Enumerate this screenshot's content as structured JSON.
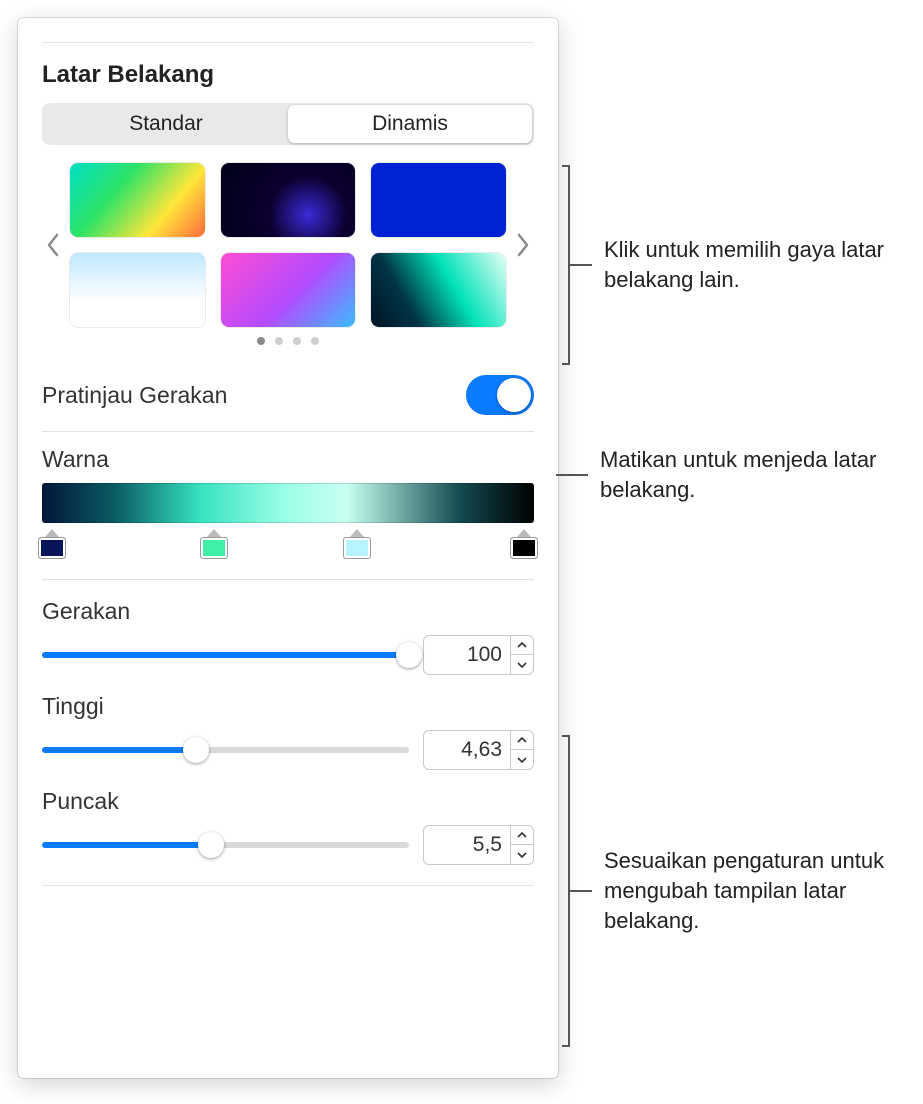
{
  "section_title": "Latar Belakang",
  "segmented": {
    "standard_label": "Standar",
    "dynamic_label": "Dinamis",
    "selected": "Dinamis"
  },
  "gallery": {
    "page_count": 4,
    "current_page": 1
  },
  "motion_preview": {
    "label": "Pratinjau Gerakan",
    "enabled": true
  },
  "color_section": {
    "label": "Warna",
    "stops": [
      {
        "position_pct": 2,
        "color": "#0a145a"
      },
      {
        "position_pct": 35,
        "color": "#3ff0a6"
      },
      {
        "position_pct": 64,
        "color": "#b8f4ff"
      },
      {
        "position_pct": 98,
        "color": "#000000"
      }
    ]
  },
  "sliders": {
    "motion": {
      "label": "Gerakan",
      "value": "100",
      "fill_pct": 100
    },
    "height": {
      "label": "Tinggi",
      "value": "4,63",
      "fill_pct": 42
    },
    "peak": {
      "label": "Puncak",
      "value": "5,5",
      "fill_pct": 46
    }
  },
  "callouts": {
    "styles": "Klik untuk memilih gaya latar belakang lain.",
    "toggle": "Matikan untuk menjeda latar belakang.",
    "settings": "Sesuaikan pengaturan untuk mengubah tampilan latar belakang."
  }
}
